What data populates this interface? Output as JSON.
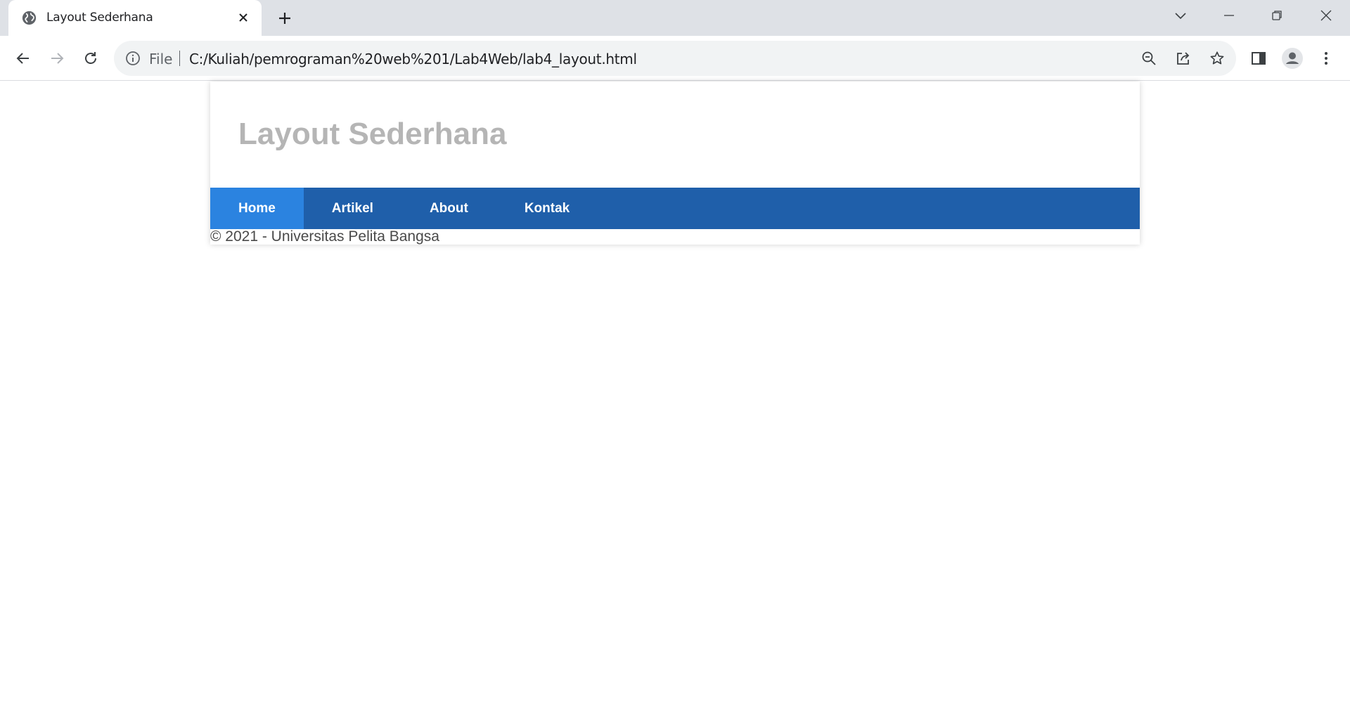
{
  "browser": {
    "tab_title": "Layout Sederhana",
    "scheme_label": "File",
    "url": "C:/Kuliah/pemrograman%20web%201/Lab4Web/lab4_layout.html"
  },
  "page": {
    "title": "Layout Sederhana",
    "nav": [
      {
        "label": "Home",
        "active": true
      },
      {
        "label": "Artikel",
        "active": false
      },
      {
        "label": "About",
        "active": false
      },
      {
        "label": "Kontak",
        "active": false
      }
    ],
    "footer": "© 2021 - Universitas Pelita Bangsa"
  },
  "colors": {
    "navbar": "#1f5faa",
    "nav_active": "#2b83e0",
    "title": "#b5b5b5"
  },
  "icons": [
    "globe-icon",
    "close-icon",
    "plus-icon",
    "chevron-down-icon",
    "minimize-icon",
    "restore-icon",
    "window-close-icon",
    "back-icon",
    "forward-icon",
    "reload-icon",
    "info-icon",
    "zoom-out-icon",
    "share-icon",
    "star-icon",
    "side-panel-icon",
    "profile-icon",
    "menu-icon"
  ]
}
